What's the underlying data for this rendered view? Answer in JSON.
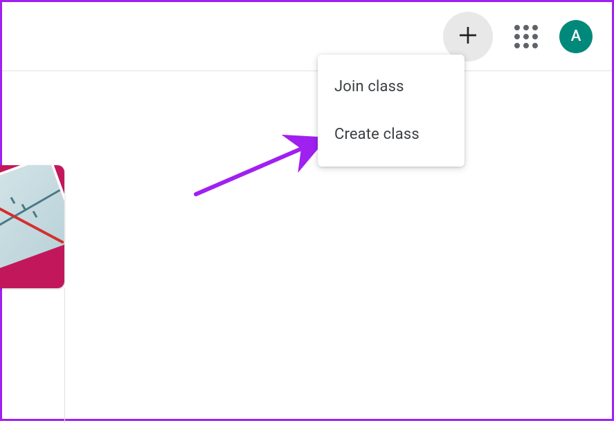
{
  "header": {
    "avatar_initial": "A"
  },
  "menu": {
    "items": [
      {
        "label": "Join class"
      },
      {
        "label": "Create class"
      }
    ]
  },
  "colors": {
    "accent": "#00897b",
    "annotation": "#a020f0",
    "card_bg": "#c2185b"
  }
}
